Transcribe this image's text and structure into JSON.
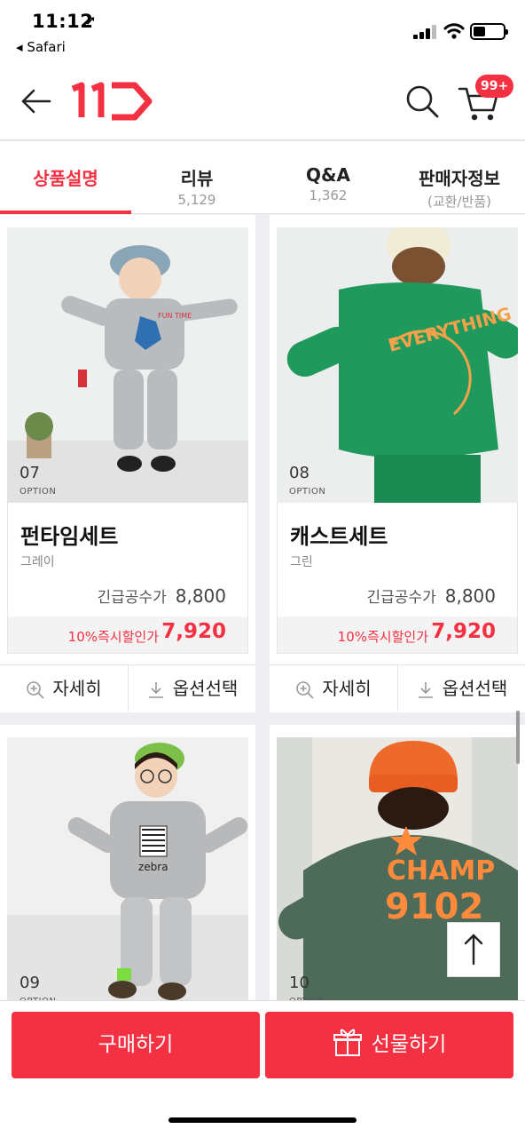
{
  "status_bar": {
    "time": "11:12",
    "back_app": "Safari",
    "battery_level": 0.4
  },
  "header": {
    "logo_text": "11",
    "cart_badge": "99+",
    "brand_color": "#f43142"
  },
  "tabs": [
    {
      "label": "상품설명",
      "sub": "",
      "active": true
    },
    {
      "label": "리뷰",
      "sub": "5,129",
      "active": false
    },
    {
      "label": "Q&A",
      "sub": "1,362",
      "active": false
    },
    {
      "label": "판매자정보",
      "sub": "(교환/반품)",
      "active": false
    }
  ],
  "products": [
    {
      "option_num": "07",
      "option_label": "OPTION",
      "name": "펀타임세트",
      "color": "그레이",
      "base_label": "긴급공수가",
      "base_price": "8,800",
      "discount_label": "10%즉시할인가",
      "discount_price": "7,920",
      "detail_label": "자세히",
      "option_select_label": "옵션선택"
    },
    {
      "option_num": "08",
      "option_label": "OPTION",
      "name": "캐스트세트",
      "color": "그린",
      "base_label": "긴급공수가",
      "base_price": "8,800",
      "discount_label": "10%즉시할인가",
      "discount_price": "7,920",
      "detail_label": "자세히",
      "option_select_label": "옵션선택"
    },
    {
      "option_num": "09",
      "option_label": "OPTION"
    },
    {
      "option_num": "10",
      "option_label": "OPTION"
    }
  ],
  "image_texts": {
    "p1_shirt": "FUN TIME",
    "p2_shirt": "EVERYTHING",
    "p3_shirt": "zebra",
    "p4_shirt_1": "CHAMP",
    "p4_shirt_2": "9102"
  },
  "bottom_bar": {
    "buy_label": "구매하기",
    "gift_label": "선물하기"
  }
}
